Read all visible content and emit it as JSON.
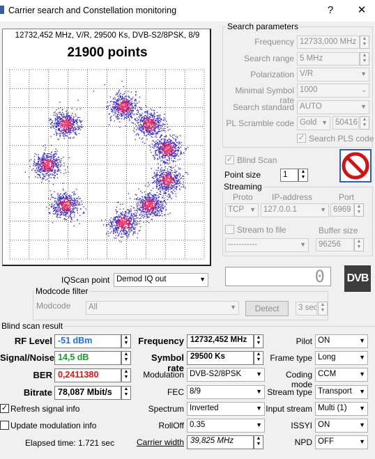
{
  "window": {
    "title": "Carrier search and Constellation monitoring",
    "help": "?",
    "close": "✕"
  },
  "constellation": {
    "info": "12732,452 MHz, V/R, 29500 Ks, DVB-S2/8PSK, 8/9",
    "points": "21900 points",
    "grid_color": "#000000",
    "point_colors": [
      "#3b2fcf",
      "#b0207a",
      "#ff3060"
    ],
    "clusters": [
      {
        "i": 0.22,
        "q": 0.82
      },
      {
        "i": 0.57,
        "q": 0.57
      },
      {
        "i": 0.82,
        "q": 0.22
      },
      {
        "i": 0.82,
        "q": -0.22
      },
      {
        "i": 0.57,
        "q": -0.57
      },
      {
        "i": 0.22,
        "q": -0.82
      },
      {
        "i": -0.57,
        "q": 0.57
      },
      {
        "i": -0.82,
        "q": 0.0
      },
      {
        "i": -0.57,
        "q": -0.57
      }
    ]
  },
  "search": {
    "group_label": "Search parameters",
    "frequency_label": "Frequency",
    "frequency_value": "12733,000 MHz",
    "range_label": "Search range",
    "range_value": "5 MHz",
    "polarization_label": "Polarization",
    "polarization_value": "V/R",
    "msr_label": "Minimal Symbol rate",
    "msr_value": "1000",
    "standard_label": "Search standard",
    "standard_value": "AUTO",
    "pls_label": "PL Scramble code",
    "pls_mode": "Gold",
    "pls_value": "50416",
    "search_pls_label": "Search PLS code",
    "search_pls_checked": "✓"
  },
  "blind": {
    "label": "Blind Scan",
    "checked": "✓",
    "pointsize_label": "Point size",
    "pointsize_value": "1"
  },
  "streaming": {
    "group_label": "Streaming",
    "proto_label": "Proto",
    "ip_label": "IP-address",
    "port_label": "Port",
    "proto_value": "TCP",
    "ip_value": "127.0.0.1",
    "port_value": "6969",
    "stream_file_label": "Stream to file",
    "buffer_label": "Buffer size",
    "file_value": "-----------",
    "buffer_value": "96256"
  },
  "iqscan": {
    "label": "IQScan point",
    "value": "Demod IQ out"
  },
  "counter": {
    "value": "0"
  },
  "logo": {
    "text": "DVB"
  },
  "modcode": {
    "group_label": "Modcode filter",
    "label": "Modcode",
    "value": "All",
    "detect": "Detect",
    "secs": "3 sec"
  },
  "result": {
    "group_label": "Blind scan result",
    "rf_label": "RF Level",
    "rf_value": "-51 dBm",
    "rf_color": "#1e6ef0",
    "sn_label": "Signal/Noise",
    "sn_value": "14,5 dB",
    "sn_color": "#1a9a2a",
    "ber_label": "BER",
    "ber_value": "0,2411380",
    "ber_color": "#e01414",
    "bitrate_label": "Bitrate",
    "bitrate_value": "78,087 Mbit/s",
    "freq_label": "Frequency",
    "freq_value": "12732,452 MHz",
    "sr_label": "Symbol rate",
    "sr_value": "29500 Ks",
    "mod_label": "Modulation",
    "mod_value": "DVB-S2/8PSK",
    "fec_label": "FEC",
    "fec_value": "8/9",
    "spec_label": "Spectrum",
    "spec_value": "Inverted",
    "roll_label": "RollOff",
    "roll_value": "0.35",
    "cw_label": "Carrier width",
    "cw_value": "39,825 MHz",
    "pilot_label": "Pilot",
    "pilot_value": "ON",
    "frame_label": "Frame type",
    "frame_value": "Long",
    "coding_label": "Coding mode",
    "coding_value": "CCM",
    "stype_label": "Stream type",
    "stype_value": "Transport",
    "istream_label": "Input stream",
    "istream_value": "Multi (1)",
    "issyi_label": "ISSYI",
    "issyi_value": "ON",
    "npd_label": "NPD",
    "npd_value": "OFF"
  },
  "options": {
    "refresh_label": "Refresh signal info",
    "refresh_checked": "✓",
    "update_label": "Update modulation info",
    "update_checked": ""
  },
  "elapsed": {
    "label": "Elapsed time: 1.721 sec"
  }
}
